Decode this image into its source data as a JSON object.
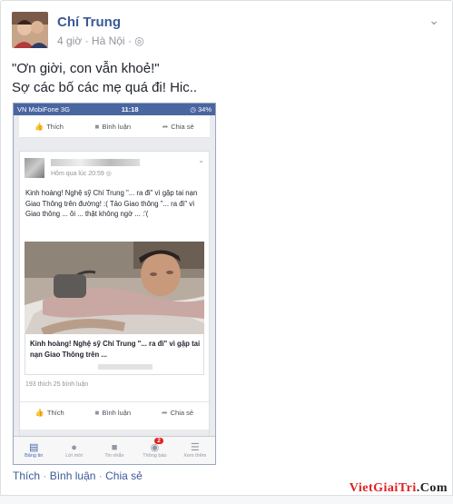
{
  "post": {
    "author": "Chí Trung",
    "time": "4 giờ",
    "location": "Hà Nội",
    "audience_icon": "globe-icon",
    "menu_icon": "chevron-down-icon",
    "message_line1": "\"Ơn giời, con vẫn khoẻ!\"",
    "message_line2": "Sợ các bố các mẹ quá đi! Hic.."
  },
  "screenshot": {
    "carrier": "VN MobiFone  3G",
    "clock": "11:18",
    "battery": "34%",
    "top_actions": {
      "like": "Thích",
      "comment": "Bình luận",
      "share": "Chia sẻ"
    },
    "card": {
      "time": "Hôm qua lúc 20:59",
      "text": "Kinh hoàng! Nghệ sỹ Chí Trung \"... ra đi\" vì gặp tai nạn Giao Thông trên đường! :( Tảo Giao thông \"... ra đi\" vì Giao thông ... ôi ... thật không ngờ ... :'(",
      "link_title": "Kinh hoàng! Nghệ sỹ Chí Trung \"... ra đi\" vì gặp tai nạn Giao Thông trên ...",
      "stats": "193 thích   25 bình luận",
      "actions": {
        "like": "Thích",
        "comment": "Bình luận",
        "share": "Chia sẻ"
      }
    },
    "tabs": [
      {
        "label": "Bảng tin",
        "icon": "news-feed-icon"
      },
      {
        "label": "Lời mời",
        "icon": "friend-requests-icon"
      },
      {
        "label": "Tin nhắn",
        "icon": "messages-icon"
      },
      {
        "label": "Thông báo",
        "icon": "notifications-icon",
        "badge": "2"
      },
      {
        "label": "Xem thêm",
        "icon": "more-menu-icon"
      }
    ]
  },
  "footer": {
    "like": "Thích",
    "comment": "Bình luận",
    "share": "Chia sẻ",
    "sep": "·"
  },
  "watermark": {
    "part1": "VietGiaiTri",
    "part2": ".Com"
  },
  "colors": {
    "link": "#3b5998",
    "statusbar": "#4a66a0",
    "badge": "#e02020",
    "watermark": "#e02020"
  }
}
